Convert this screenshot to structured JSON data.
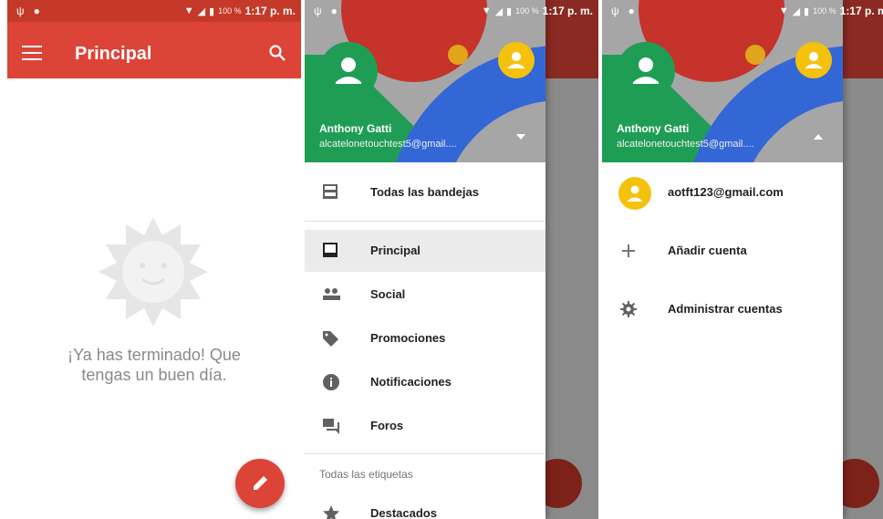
{
  "status": {
    "battery": "100 %",
    "time": "1:17 p. m."
  },
  "panel1": {
    "title": "Principal",
    "empty_line1": "¡Ya has terminado! Que",
    "empty_line2": "tengas un buen día."
  },
  "drawer": {
    "name": "Anthony Gatti",
    "email": "alcatelonetouchtest5@gmail....",
    "all_inboxes": "Todas las bandejas",
    "items": [
      {
        "label": "Principal",
        "icon": "inbox-icon"
      },
      {
        "label": "Social",
        "icon": "people-icon"
      },
      {
        "label": "Promociones",
        "icon": "tag-icon"
      },
      {
        "label": "Notificaciones",
        "icon": "info-icon"
      },
      {
        "label": "Foros",
        "icon": "forum-icon"
      }
    ],
    "section_label": "Todas las etiquetas",
    "starred": "Destacados"
  },
  "accounts": {
    "other_account": "aotft123@gmail.com",
    "add": "Añadir cuenta",
    "manage": "Administrar cuentas"
  },
  "colors": {
    "brand_red": "#db4437",
    "avatar_green": "#1f9d55",
    "avatar_yellow": "#f4c20d"
  }
}
